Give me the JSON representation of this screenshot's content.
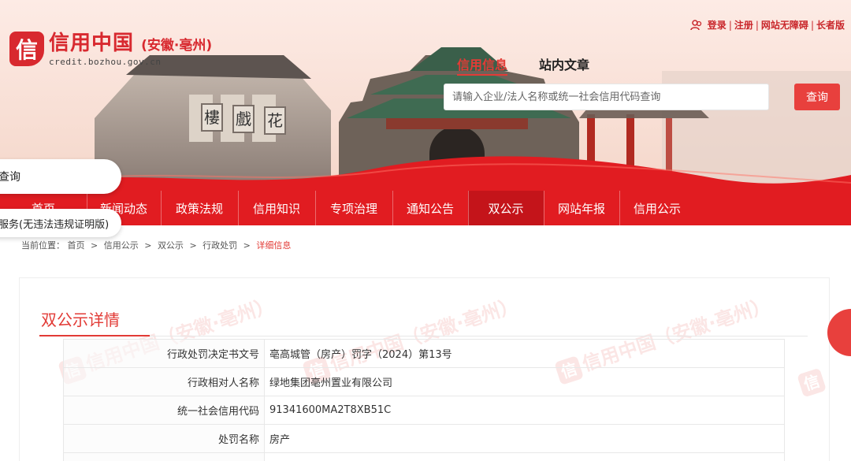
{
  "logo": {
    "mark": "信",
    "title": "信用中国",
    "region": "(安徽·亳州)",
    "domain": "credit.bozhou.gov.cn"
  },
  "top_links": {
    "login": "登录",
    "register": "注册",
    "accessible": "网站无障碍",
    "elder": "长者版"
  },
  "search": {
    "tabs": [
      "信用信息",
      "站内文章"
    ],
    "placeholder": "请输入企业/法人名称或统一社会信用代码查询",
    "button": "查询"
  },
  "banner_signs": [
    "花",
    "戲",
    "樓"
  ],
  "nav": {
    "items": [
      "首页",
      "新闻动态",
      "政策法规",
      "信用知识",
      "专项治理",
      "通知公告",
      "双公示",
      "网站年报",
      "信用公示"
    ],
    "active_index": 6
  },
  "floating": {
    "pill1": "查询",
    "pill2": "服务(无违法违规证明版)"
  },
  "breadcrumb": {
    "prefix": "当前位置：",
    "items": [
      "首页",
      "信用公示",
      "双公示",
      "行政处罚"
    ],
    "current": "详细信息"
  },
  "section": {
    "title": "双公示详情"
  },
  "details": [
    {
      "label": "行政处罚决定书文号",
      "value": "亳高城管（房产）罚字（2024）第13号"
    },
    {
      "label": "行政相对人名称",
      "value": "绿地集团亳州置业有限公司"
    },
    {
      "label": "统一社会信用代码",
      "value": "91341600MA2T8XB51C"
    },
    {
      "label": "处罚名称",
      "value": "房产"
    },
    {
      "label": "",
      "value": ""
    }
  ],
  "watermark": "信用中国（安徽·亳州）",
  "colors": {
    "brand_red": "#e11c21",
    "accent_red": "#e23b36"
  }
}
